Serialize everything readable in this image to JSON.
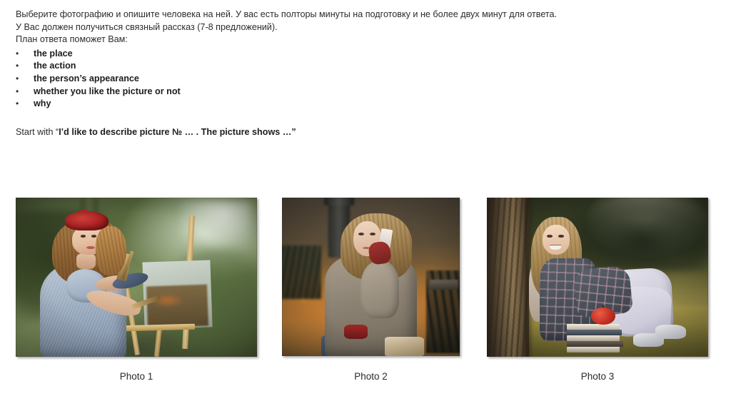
{
  "task": {
    "line1": "Выберите фотографию и опишите человека на ней. У вас есть полторы минуты на подготовку и не более двух минут для ответа.",
    "line2": "У Вас должен получиться связный рассказ (7-8 предложений).",
    "line3": "План ответа поможет Вам:",
    "bullet_char": "•",
    "bullets": [
      {
        "label": "the place"
      },
      {
        "label": "the action"
      },
      {
        "label": "the person’s appearance"
      },
      {
        "label": "whether you like the picture or not"
      },
      {
        "label": "why"
      }
    ],
    "start_prefix": "Start with “",
    "start_quote": "I’d like to describe picture № … . The picture shows …",
    "start_suffix": "”"
  },
  "photos": [
    {
      "caption": "Photo 1",
      "alt": "young woman in a red beret painting on an easel in a green park"
    },
    {
      "caption": "Photo 2",
      "alt": "girl in a grey jacket talking on a mobile phone on a park bench in autumn"
    },
    {
      "caption": "Photo 3",
      "alt": "smiling girl in a plaid pinafore sitting against a tree with a stack of books and an apple"
    }
  ],
  "colors": {
    "background": "#ffffff",
    "text": "#2b2b2b",
    "bold_text": "#1d1d1d"
  }
}
